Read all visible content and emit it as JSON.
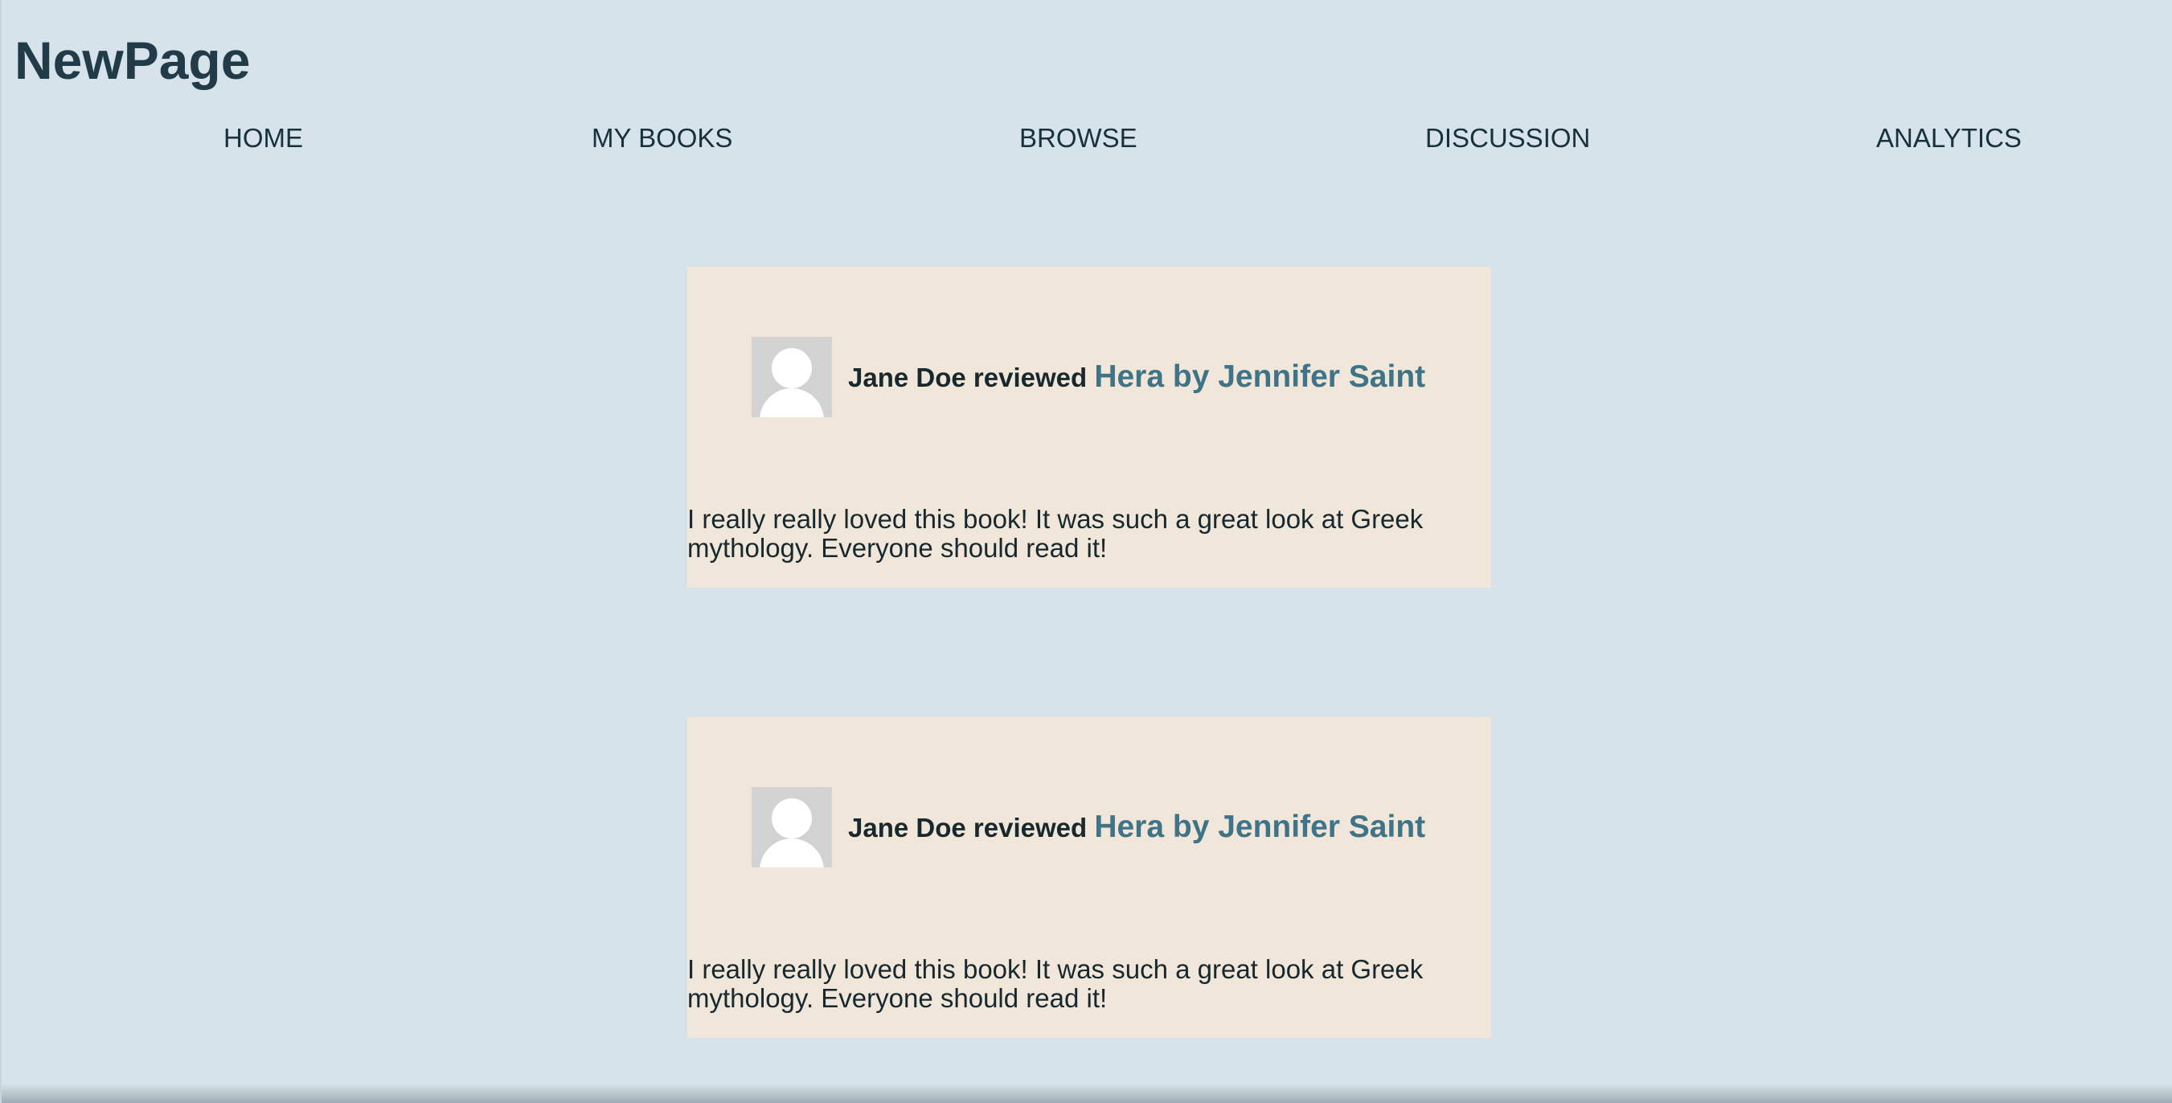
{
  "app": {
    "title": "NewPage"
  },
  "nav": {
    "items": [
      {
        "label": "HOME"
      },
      {
        "label": "MY BOOKS"
      },
      {
        "label": "BROWSE"
      },
      {
        "label": "DISCUSSION"
      },
      {
        "label": "ANALYTICS"
      }
    ]
  },
  "reviews": [
    {
      "reviewer": "Jane Doe reviewed",
      "book": "Hera by Jennifer Saint",
      "text": "I really really loved this book! It was such a great look at Greek mythology. Everyone should read it!"
    },
    {
      "reviewer": "Jane Doe reviewed",
      "book": "Hera by Jennifer Saint",
      "text": "I really really loved this book! It was such a great look at Greek mythology. Everyone should read it!"
    }
  ],
  "colors": {
    "background": "#d7e3ea",
    "card": "#f0e6da",
    "title": "#213b49",
    "link": "#3e7388",
    "avatar": "#d2d2d2"
  },
  "icons": {
    "avatar": "user-avatar-icon"
  }
}
